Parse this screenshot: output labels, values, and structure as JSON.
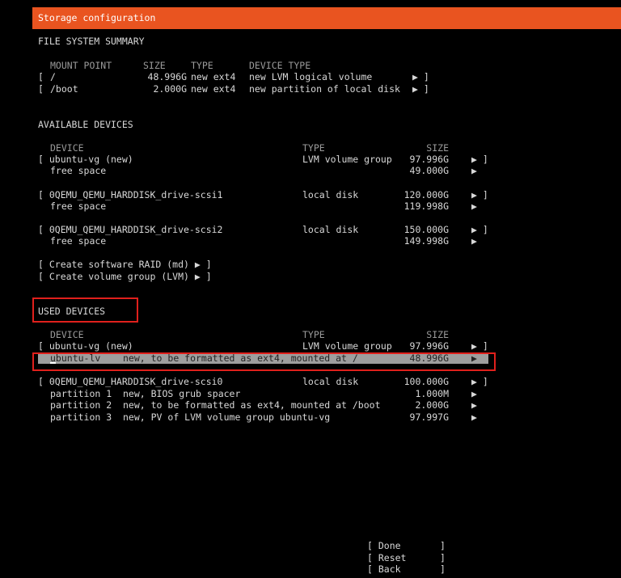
{
  "title": "Storage configuration",
  "fs_summary": {
    "heading": "FILE SYSTEM SUMMARY",
    "headers": {
      "mount": "MOUNT POINT",
      "size": "SIZE",
      "type": "TYPE",
      "device_type": "DEVICE TYPE"
    },
    "rows": [
      {
        "bracket_open": "[",
        "mount": "/",
        "size": "48.996G",
        "type": "new ext4",
        "device_type": "new LVM logical volume",
        "arrow": "▶ ]"
      },
      {
        "bracket_open": "[",
        "mount": "/boot",
        "size": "2.000G",
        "type": "new ext4",
        "device_type": "new partition of local disk",
        "arrow": "▶ ]"
      }
    ]
  },
  "available": {
    "heading": "AVAILABLE DEVICES",
    "headers": {
      "device": "DEVICE",
      "type": "TYPE",
      "size": "SIZE"
    },
    "rows": [
      {
        "device": "[ ubuntu-vg (new)",
        "type": "LVM volume group",
        "size": "97.996G",
        "arrow": "▶ ]"
      },
      {
        "device": "free space",
        "type": "",
        "size": "49.000G",
        "arrow": "▶"
      },
      {
        "device": "[ 0QEMU_QEMU_HARDDISK_drive-scsi1",
        "type": "local disk",
        "size": "120.000G",
        "arrow": "▶ ]"
      },
      {
        "device": "free space",
        "type": "",
        "size": "119.998G",
        "arrow": "▶"
      },
      {
        "device": "[ 0QEMU_QEMU_HARDDISK_drive-scsi2",
        "type": "local disk",
        "size": "150.000G",
        "arrow": "▶ ]"
      },
      {
        "device": "free space",
        "type": "",
        "size": "149.998G",
        "arrow": "▶"
      }
    ],
    "actions": [
      "[ Create software RAID (md) ▶ ]",
      "[ Create volume group (LVM) ▶ ]"
    ]
  },
  "used": {
    "heading": "USED DEVICES",
    "headers": {
      "device": "DEVICE",
      "type": "TYPE",
      "size": "SIZE"
    },
    "rows": [
      {
        "device": "[ ubuntu-vg (new)",
        "type": "LVM volume group",
        "size": "97.996G",
        "arrow": "▶ ]"
      },
      {
        "device": "ubuntu-lv    new, to be formatted as ext4, mounted at /",
        "type": "",
        "size": "48.996G",
        "arrow": "▶"
      },
      {
        "device": "[ 0QEMU_QEMU_HARDDISK_drive-scsi0",
        "type": "local disk",
        "size": "100.000G",
        "arrow": "▶ ]"
      },
      {
        "device": "partition 1  new, BIOS grub spacer",
        "type": "",
        "size": "1.000M",
        "arrow": "▶"
      },
      {
        "device": "partition 2  new, to be formatted as ext4, mounted at /boot",
        "type": "",
        "size": "2.000G",
        "arrow": "▶"
      },
      {
        "device": "partition 3  new, PV of LVM volume group ubuntu-vg",
        "type": "",
        "size": "97.997G",
        "arrow": "▶"
      }
    ]
  },
  "buttons": {
    "done": "[ Done       ]",
    "reset": "[ Reset      ]",
    "back": "[ Back       ]"
  },
  "colors": {
    "accent": "#e95420",
    "highlight": "#9e9e9e",
    "annotation": "#e0201c"
  }
}
